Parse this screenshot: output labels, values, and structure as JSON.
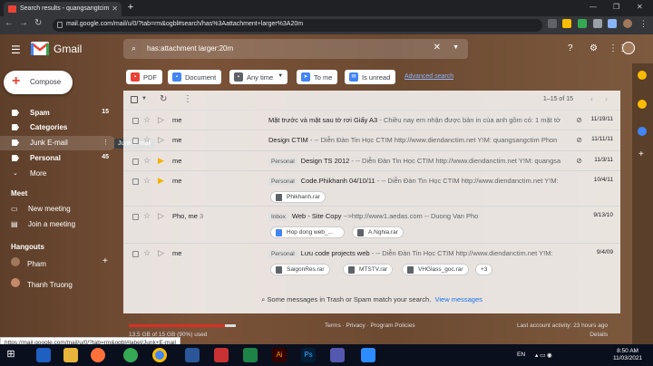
{
  "browser": {
    "tab_title": "Search results - quangsangtcim",
    "new_tab": "+",
    "url": "mail.google.com/mail/u/0/?tab=rm&ogbl#search/has%3Aattachment+larger%3A20m"
  },
  "gmail": {
    "logo_text": "Gmail",
    "search_query": "has:attachment larger:20m",
    "compose_label": "Compose"
  },
  "sidebar": {
    "items": [
      {
        "label": "Spam",
        "count": "15"
      },
      {
        "label": "Categories",
        "count": ""
      },
      {
        "label": "Junk E-mail",
        "count": ""
      },
      {
        "label": "Personal",
        "count": "45"
      },
      {
        "label": "More",
        "count": ""
      }
    ],
    "tooltip": "Junk E-mail",
    "meet_heading": "Meet",
    "meet_items": [
      "New meeting",
      "Join a meeting"
    ],
    "hangouts_heading": "Hangouts",
    "hangouts_users": [
      "Pham",
      "Thanh Truong"
    ]
  },
  "filters": {
    "chips": [
      "PDF",
      "Document",
      "Any time",
      "To me",
      "Is unread"
    ],
    "advanced": "Advanced search"
  },
  "toolbar": {
    "pagination": "1–15 of 15"
  },
  "emails": [
    {
      "sender": "me",
      "label": "",
      "subject": "Mặt trước và mặt sau tờ rơi Giấy A3",
      "snippet": " - Chiều nay em nhận được bản in của anh gồm có: 1 mặt tờ",
      "date": "11/19/11",
      "starred": false,
      "clip": true
    },
    {
      "sender": "me",
      "label": "",
      "subject": "Design CTIM",
      "snippet": " - -- Diễn Đàn Tin Học CTIM http://www.diendanctim.net Y!M: quangsangctim Phon",
      "date": "11/11/11",
      "starred": false,
      "clip": true
    },
    {
      "sender": "me",
      "label": "Personal",
      "subject": "Design TS 2012",
      "snippet": " - -- Diễn Đàn Tin Học CTIM http://www.diendanctim.net Y!M: quangsa",
      "date": "11/3/11",
      "starred": true,
      "clip": true
    },
    {
      "sender": "me",
      "label": "Personal",
      "subject": "Code.Phikhanh 04/10/11",
      "snippet": " - -- Diễn Đàn Tin Học CTIM http://www.diendanctim.net Y!M:",
      "date": "10/4/11",
      "starred": true,
      "clip": false,
      "attachments": [
        "Phikhanh.rar"
      ]
    },
    {
      "sender": "Pho, me",
      "sender_count": "3",
      "label": "Inbox",
      "subject": "Web - Site Copy",
      "snippet": " -->http://www1.aedas.com -- Duong Van Pho",
      "date": "9/13/10",
      "starred": false,
      "clip": false,
      "attachments": [
        "Hop dong web_...",
        "A.Nghia.rar"
      ]
    },
    {
      "sender": "me",
      "label": "Personal",
      "subject": "Lưu code projects web",
      "snippet": " - -- Diễn Đàn Tin Học CTIM http://www.diendanctim.net Y!M:",
      "date": "9/4/09",
      "starred": false,
      "clip": false,
      "attachments": [
        "SaigonRes.rar",
        "MTSTV.rar",
        "VHGlass_goc.rar"
      ],
      "more_attachments": "+3"
    }
  ],
  "notice": {
    "text": "Some messages in Trash or Spam match your search.",
    "link": "View messages"
  },
  "footer": {
    "usage": "13.5 GB of 15 GB (90%) used",
    "usage_fraction": 0.9,
    "terms": "Terms · Privacy · Program Policies",
    "activity": "Last account activity: 23 hours ago",
    "details": "Details"
  },
  "status_url": "https://mail.google.com/mail/u/0/?tab=rm&ogbl#label/Junk+E-mail",
  "taskbar": {
    "lang": "EN",
    "time": "8:50 AM",
    "date": "11/03/2021"
  }
}
